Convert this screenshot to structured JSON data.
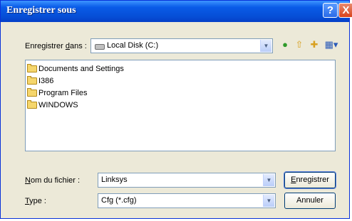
{
  "window": {
    "title": "Enregistrer sous",
    "help_label": "?",
    "close_label": "X"
  },
  "save_in": {
    "label_prefix": "Enregistrer ",
    "label_accel": "d",
    "label_suffix": "ans :",
    "value": "Local Disk (C:)"
  },
  "toolbar": {
    "icons": [
      "back-icon",
      "up-folder-icon",
      "new-folder-icon",
      "view-menu-icon"
    ]
  },
  "files": [
    {
      "name": "Documents and Settings"
    },
    {
      "name": "I386"
    },
    {
      "name": "Program Files"
    },
    {
      "name": "WINDOWS"
    }
  ],
  "filename": {
    "label_accel": "N",
    "label_rest": "om du fichier :",
    "value": "Linksys"
  },
  "filetype": {
    "label_accel": "T",
    "label_rest": "ype :",
    "value": "Cfg (*.cfg)"
  },
  "buttons": {
    "save_accel": "E",
    "save_rest": "nregistrer",
    "cancel": "Annuler"
  },
  "colors": {
    "title_bar": "#0a5ce8",
    "dialog_bg": "#ece9d8",
    "close": "#d8431c"
  }
}
